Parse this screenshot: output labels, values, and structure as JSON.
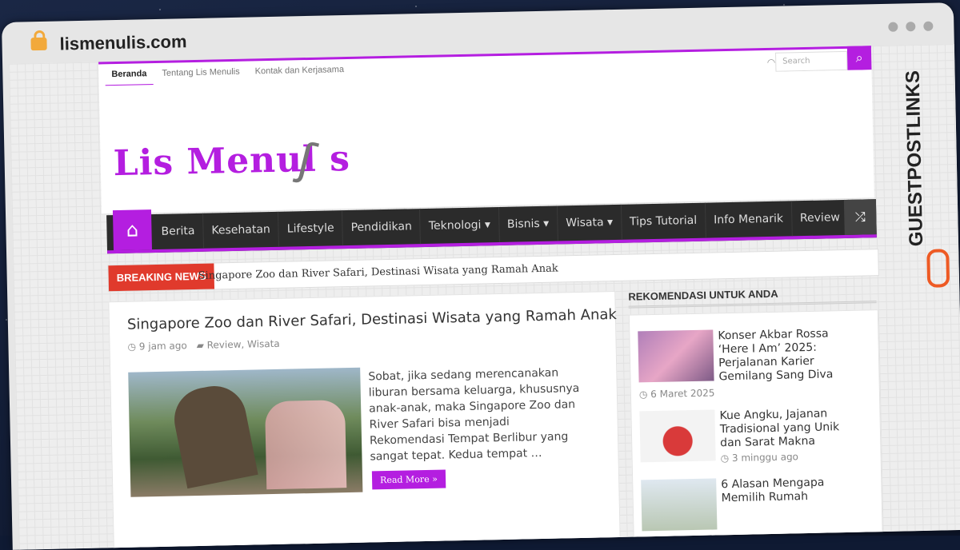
{
  "browser": {
    "url": "lismenulis.com"
  },
  "topbar": {
    "nav": [
      "Beranda",
      "Tentang Lis Menulis",
      "Kontak dan Kerjasama"
    ],
    "search_placeholder": "Search"
  },
  "header": {
    "logo_text": "Lis Menul s"
  },
  "mainnav": {
    "items": [
      "Berita",
      "Kesehatan",
      "Lifestyle",
      "Pendidikan",
      "Teknologi ▾",
      "Bisnis ▾",
      "Wisata ▾",
      "Tips Tutorial",
      "Info Menarik",
      "Review"
    ]
  },
  "breaking": {
    "label": "BREAKING NEWS",
    "headline": "Singapore Zoo dan River Safari, Destinasi Wisata yang Ramah Anak"
  },
  "post": {
    "title": "Singapore Zoo dan River Safari, Destinasi Wisata yang Ramah Anak",
    "time": "9 jam ago",
    "categories": "Review, Wisata",
    "excerpt": "Sobat, jika sedang merencanakan liburan bersama keluarga, khususnya anak-anak, maka Singapore Zoo dan River Safari bisa menjadi Rekomendasi Tempat Berlibur yang sangat tepat. Kedua tempat …",
    "read_more": "Read More »"
  },
  "sidebar": {
    "title": "REKOMENDASI UNTUK ANDA",
    "items": [
      {
        "title": "Konser Akbar Rossa ‘Here I Am’ 2025: Perjalanan Karier Gemilang Sang Diva",
        "date": "6 Maret 2025"
      },
      {
        "title": "Kue Angku, Jajanan Tradisional yang Unik dan Sarat Makna",
        "date": "3 minggu ago"
      },
      {
        "title": "6 Alasan Mengapa Memilih Rumah",
        "date": ""
      }
    ]
  },
  "watermark": {
    "text": "GUESTPOSTLINKS"
  },
  "colors": {
    "accent": "#b41ee0",
    "breaking": "#e03a2c",
    "nav_bg": "#2b2b2b"
  }
}
